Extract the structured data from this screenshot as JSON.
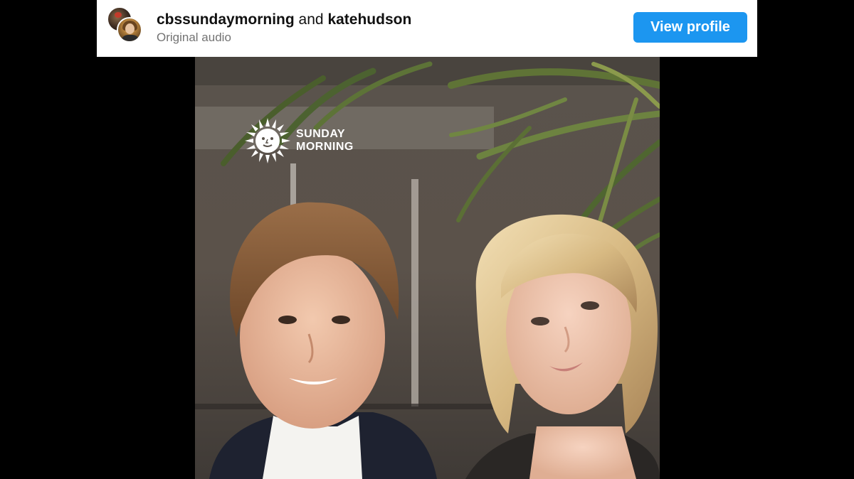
{
  "header": {
    "account_primary": "cbssundaymorning",
    "conjunction": "and",
    "account_secondary": "katehudson",
    "audio_label": "Original audio",
    "view_profile_label": "View profile"
  },
  "video": {
    "logo_line1": "SUNDAY",
    "logo_line2": "MORNING"
  },
  "colors": {
    "button": "#1c96f0",
    "subtitle": "#737373",
    "background": "#000000"
  },
  "icons": {
    "avatar_back": "profile-avatar-icon",
    "avatar_front": "profile-avatar-icon",
    "logo": "sun-logo-icon"
  }
}
